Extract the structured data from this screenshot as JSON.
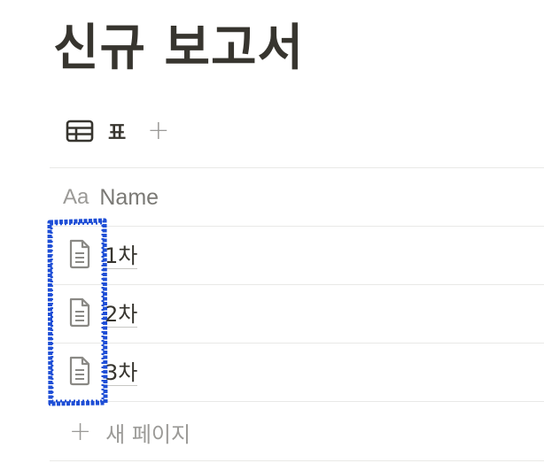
{
  "page": {
    "title": "신규 보고서"
  },
  "view": {
    "tab_icon": "table-icon",
    "tab_label": "표",
    "add_view_icon": "plus-icon"
  },
  "table": {
    "header_icon": "Aa",
    "header_label": "Name",
    "rows": [
      {
        "label": "1차",
        "icon": "document-icon"
      },
      {
        "label": "2차",
        "icon": "document-icon"
      },
      {
        "label": "3차",
        "icon": "document-icon"
      }
    ],
    "new_page_label": "새 페이지"
  },
  "colors": {
    "text": "#37352f",
    "muted": "#9b9a97",
    "divider": "#e9e9e7",
    "highlight": "#1f4fd6"
  }
}
